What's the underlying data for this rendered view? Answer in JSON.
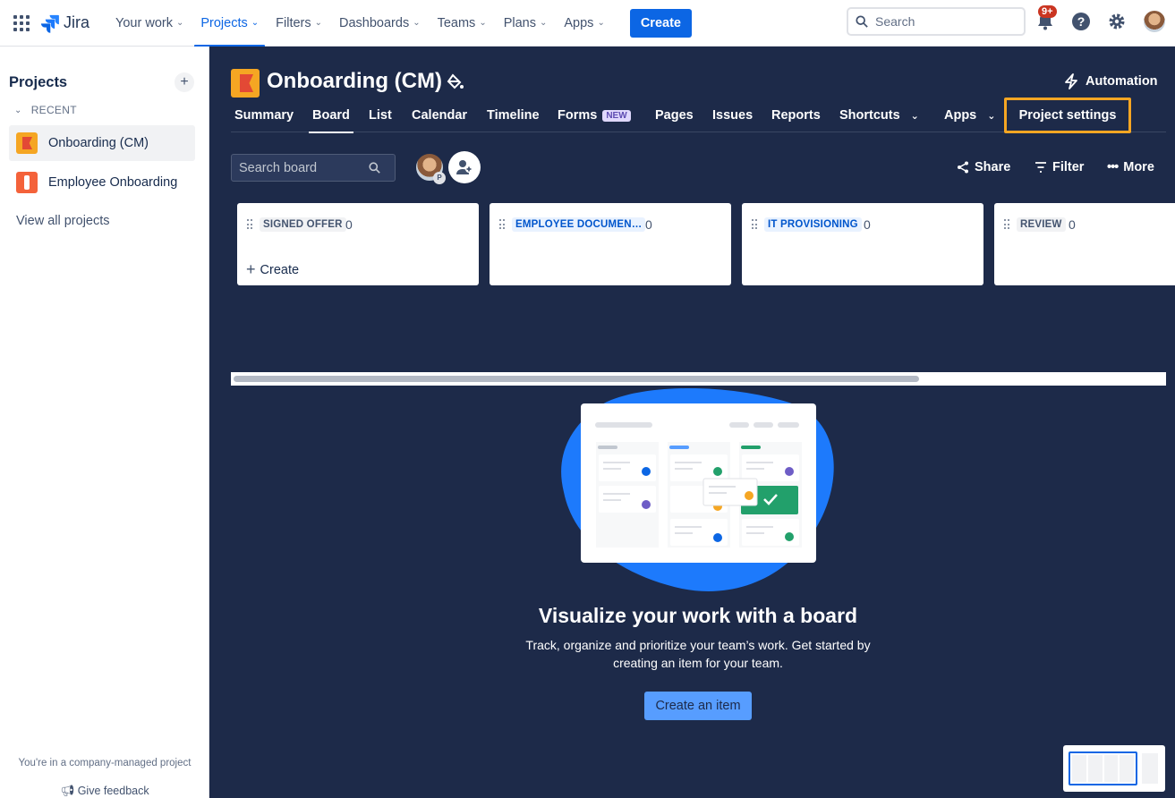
{
  "topnav": {
    "logo": "Jira",
    "items": [
      "Your work",
      "Projects",
      "Filters",
      "Dashboards",
      "Teams",
      "Plans",
      "Apps"
    ],
    "create": "Create",
    "search_placeholder": "Search",
    "notifications_badge": "9+"
  },
  "sidebar": {
    "title": "Projects",
    "add": "+",
    "recent": "RECENT",
    "projects": [
      "Onboarding (CM)",
      "Employee Onboarding"
    ],
    "view_all": "View all projects",
    "footer_note": "You're in a company-managed project",
    "feedback": "Give feedback"
  },
  "main": {
    "title": "Onboarding (CM)",
    "automation": "Automation",
    "tabs": [
      "Summary",
      "Board",
      "List",
      "Calendar",
      "Timeline",
      "Forms",
      "Pages",
      "Issues",
      "Reports",
      "Shortcuts",
      "Apps"
    ],
    "new_badge": "NEW",
    "project_settings": "Project settings",
    "search_board_placeholder": "Search board",
    "avatar_letter": "P",
    "share": "Share",
    "filter": "Filter",
    "more": "More",
    "columns": [
      {
        "name": "SIGNED OFFER",
        "count": "0",
        "create": "Create"
      },
      {
        "name": "EMPLOYEE DOCUMEN…",
        "count": "0"
      },
      {
        "name": "IT PROVISIONING",
        "count": "0"
      },
      {
        "name": "REVIEW",
        "count": "0"
      }
    ],
    "empty_title": "Visualize your work with a board",
    "empty_desc": "Track, organize and prioritize your team’s work. Get started by creating an item for your team.",
    "empty_button": "Create an item"
  }
}
